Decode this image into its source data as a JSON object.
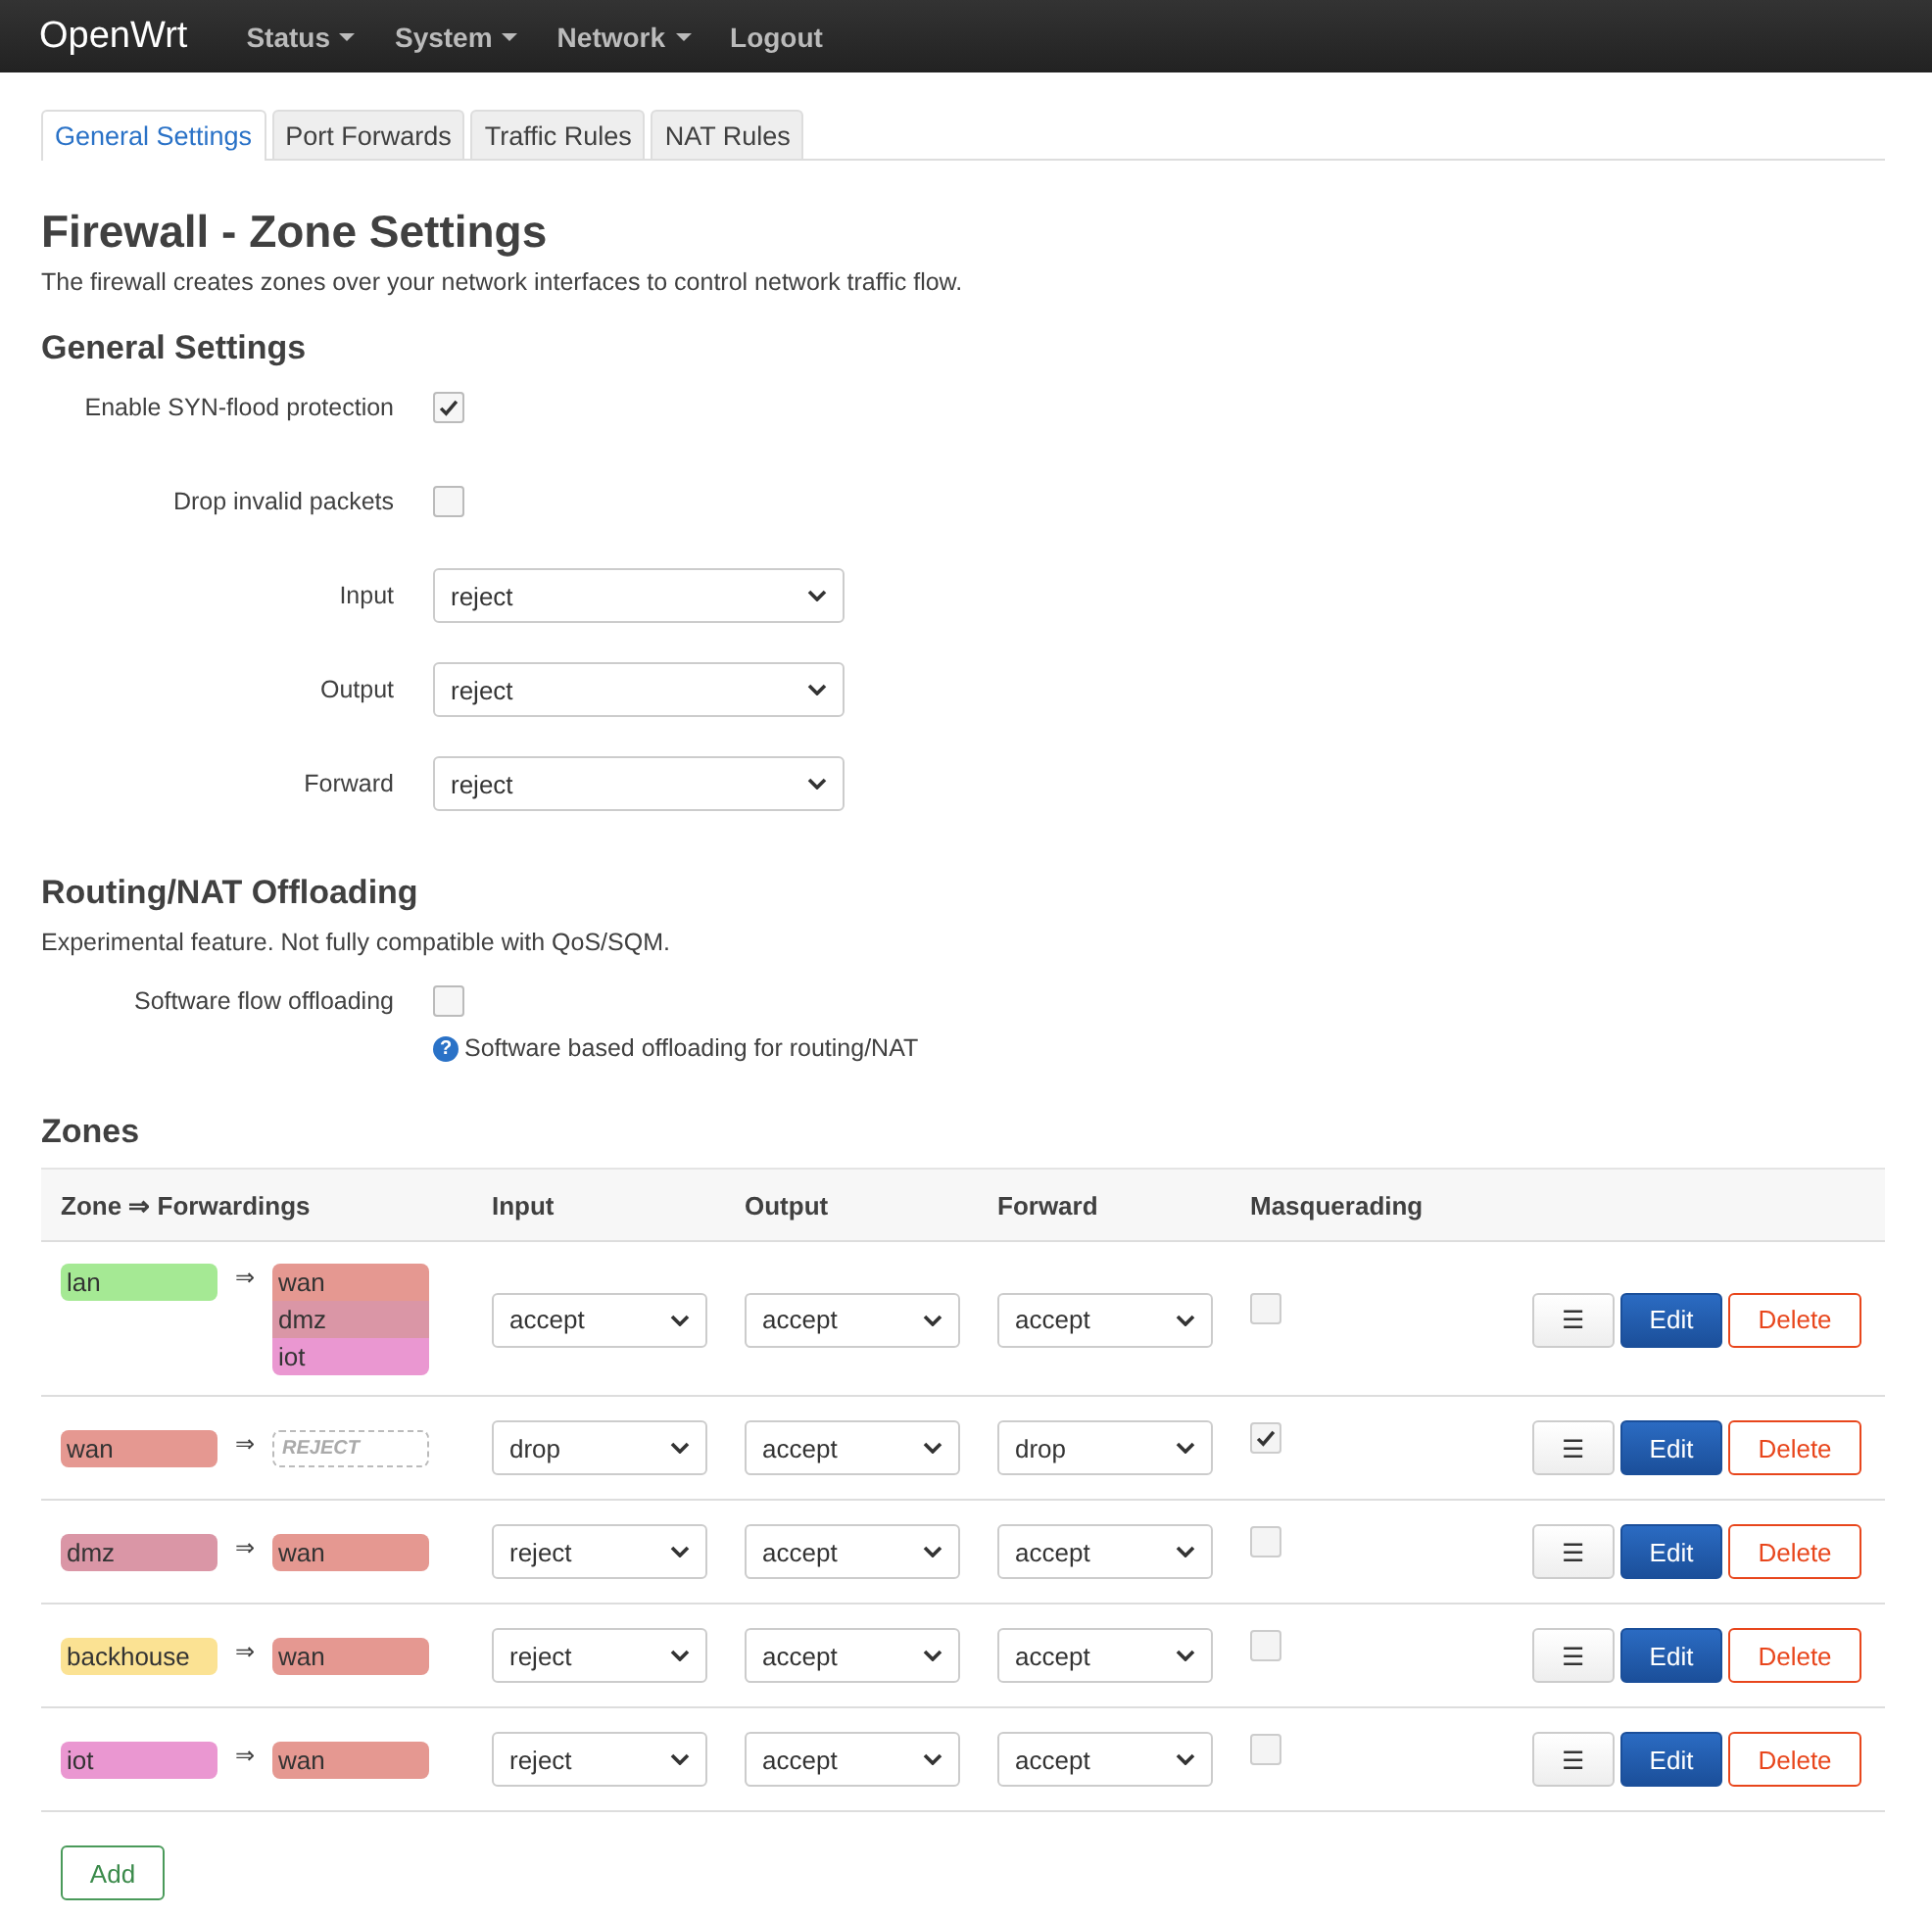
{
  "brand": "OpenWrt",
  "menu": [
    {
      "label": "Status",
      "dropdown": true
    },
    {
      "label": "System",
      "dropdown": true
    },
    {
      "label": "Network",
      "dropdown": true
    },
    {
      "label": "Logout",
      "dropdown": false
    }
  ],
  "tabs": [
    {
      "label": "General Settings",
      "selected": true
    },
    {
      "label": "Port Forwards",
      "selected": false
    },
    {
      "label": "Traffic Rules",
      "selected": false
    },
    {
      "label": "NAT Rules",
      "selected": false
    }
  ],
  "title": "Firewall - Zone Settings",
  "description": "The firewall creates zones over your network interfaces to control network traffic flow.",
  "general": {
    "heading": "General Settings",
    "fields": [
      {
        "kind": "checkbox",
        "label": "Enable SYN-flood protection",
        "checked": true
      },
      {
        "kind": "checkbox",
        "label": "Drop invalid packets",
        "checked": false
      },
      {
        "kind": "select",
        "label": "Input",
        "value": "reject"
      },
      {
        "kind": "select",
        "label": "Output",
        "value": "reject"
      },
      {
        "kind": "select",
        "label": "Forward",
        "value": "reject"
      }
    ]
  },
  "offloading": {
    "heading": "Routing/NAT Offloading",
    "description": "Experimental feature. Not fully compatible with QoS/SQM.",
    "fields": [
      {
        "kind": "checkbox",
        "label": "Software flow offloading",
        "checked": false,
        "help_icon": "?",
        "help": "Software based offloading for routing/NAT"
      }
    ]
  },
  "zones": {
    "heading": "Zones",
    "columns": [
      "Zone ⇒ Forwardings",
      "Input",
      "Output",
      "Forward",
      "Masquerading"
    ],
    "rows": [
      {
        "zone": "lan",
        "color": "#a5e994",
        "arrow": "⇒",
        "forwardings": [
          {
            "kind": "zone",
            "label": "wan",
            "color": "#e59891"
          },
          {
            "kind": "zone",
            "label": "dmz",
            "color": "#da96a6"
          },
          {
            "kind": "zone",
            "label": "iot",
            "color": "#ea97d1"
          }
        ],
        "input": "accept",
        "output": "accept",
        "forward": "accept",
        "masquerading": false,
        "menu_glyph": "☰",
        "edit": "Edit",
        "delete": "Delete"
      },
      {
        "zone": "wan",
        "color": "#e59891",
        "arrow": "⇒",
        "forwardings": [
          {
            "kind": "none",
            "label": "REJECT"
          }
        ],
        "input": "drop",
        "output": "accept",
        "forward": "drop",
        "masquerading": true,
        "menu_glyph": "☰",
        "edit": "Edit",
        "delete": "Delete"
      },
      {
        "zone": "dmz",
        "color": "#da96a6",
        "arrow": "⇒",
        "forwardings": [
          {
            "kind": "zone",
            "label": "wan",
            "color": "#e59891"
          }
        ],
        "input": "reject",
        "output": "accept",
        "forward": "accept",
        "masquerading": false,
        "menu_glyph": "☰",
        "edit": "Edit",
        "delete": "Delete"
      },
      {
        "zone": "backhouse",
        "color": "#fbe293",
        "arrow": "⇒",
        "forwardings": [
          {
            "kind": "zone",
            "label": "wan",
            "color": "#e59891"
          }
        ],
        "input": "reject",
        "output": "accept",
        "forward": "accept",
        "masquerading": false,
        "menu_glyph": "☰",
        "edit": "Edit",
        "delete": "Delete"
      },
      {
        "zone": "iot",
        "color": "#ea97d1",
        "arrow": "⇒",
        "forwardings": [
          {
            "kind": "zone",
            "label": "wan",
            "color": "#e59891"
          }
        ],
        "input": "reject",
        "output": "accept",
        "forward": "accept",
        "masquerading": false,
        "menu_glyph": "☰",
        "edit": "Edit",
        "delete": "Delete"
      }
    ],
    "add": "Add"
  }
}
